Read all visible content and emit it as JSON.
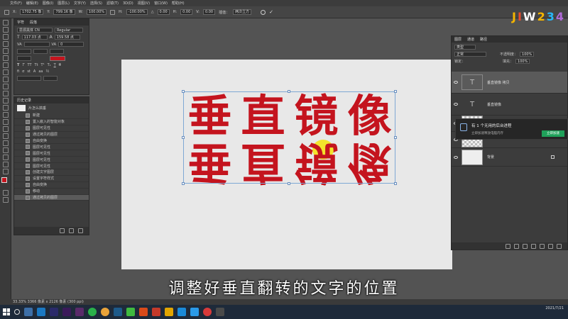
{
  "menubar": {
    "items": [
      "文件(F)",
      "编辑(E)",
      "图像(I)",
      "图层(L)",
      "文字(Y)",
      "选择(S)",
      "滤镜(T)",
      "3D(D)",
      "视图(V)",
      "窗口(W)",
      "帮助(H)"
    ]
  },
  "optbar": {
    "x_label": "X:",
    "x_value": "1702.75 像",
    "y_label": "Y:",
    "y_value": "799.16 像",
    "w_label": "W:",
    "w_value": "100.00%",
    "h_label": "H:",
    "h_value": "-100.00%",
    "angle_label": "△",
    "angle_value": "0.00",
    "h_skew_label": "H:",
    "h_skew_value": "0.00",
    "v_skew_label": "V:",
    "v_skew_value": "0.00",
    "interp_label": "插值：",
    "interp_value": "两次立方"
  },
  "char_panel": {
    "tabs": [
      "字符",
      "段落"
    ],
    "font": "思源黑体 CN",
    "style": "Regular",
    "size": "117.03 点",
    "leading": "159.58 点",
    "tracking": "0",
    "color": "#c4141e"
  },
  "history_panel": {
    "title": "历史记录",
    "doc": "片怎么搞垂",
    "items": [
      "新建",
      "置入嵌入的智能对象",
      "图层可见性",
      "通过拷贝的图层",
      "自由变换",
      "图层可见性",
      "图层可见性",
      "图层可见性",
      "图层可见性",
      "创建文字图层",
      "设置字符样式",
      "自由变换",
      "移动",
      "通过拷贝的图层"
    ]
  },
  "canvas": {
    "text_top": [
      "垂",
      "直",
      "镜",
      "像"
    ],
    "text_bottom": [
      "垂",
      "直",
      "镜",
      "像"
    ]
  },
  "layers_panel": {
    "tabs": [
      "图层",
      "通道",
      "路径"
    ],
    "kind": "类型",
    "blend": "正常",
    "opacity_label": "不透明度：",
    "opacity": "100%",
    "fill_label": "填充：",
    "fill": "100%",
    "lock_label": "锁定：",
    "layers": [
      {
        "name": "垂直镜像 拷贝",
        "thumb": "T"
      },
      {
        "name": "垂直镜像",
        "thumb": "T"
      },
      {
        "name": "",
        "thumb": ""
      },
      {
        "name": "",
        "thumb": ""
      },
      {
        "name": "背景",
        "thumb": ""
      }
    ]
  },
  "popup": {
    "title": "有 1 个无用的后台进程",
    "subtitle": "立即加速释放电脑内存",
    "button": "立即加速"
  },
  "status": {
    "text": "33.33%  3366 像素 x 2126 像素 (300 ppi)"
  },
  "subtitle": "调整好垂直翻转的文字的位置",
  "logo": {
    "letters": [
      "J",
      "I",
      "W",
      "2",
      "3",
      "4"
    ],
    "colors": [
      "#f5b500",
      "#e94c2c",
      "#ffffff",
      "#f5b500",
      "#29b6f6",
      "#b06ad8"
    ]
  },
  "taskbar": {
    "time": "",
    "date": "2021/7/21"
  }
}
